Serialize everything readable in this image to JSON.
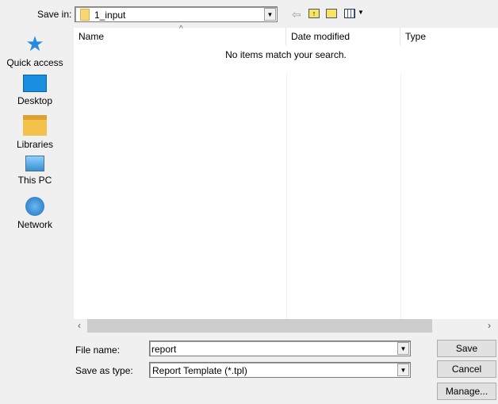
{
  "toolbar": {
    "save_in_label": "Save in:",
    "folder": "1_input"
  },
  "sidebar": {
    "items": [
      {
        "label": "Quick access",
        "icon": "star-icon"
      },
      {
        "label": "Desktop",
        "icon": "desktop-icon"
      },
      {
        "label": "Libraries",
        "icon": "libraries-icon"
      },
      {
        "label": "This PC",
        "icon": "computer-icon"
      },
      {
        "label": "Network",
        "icon": "network-icon"
      }
    ]
  },
  "list": {
    "columns": [
      "Name",
      "Date modified",
      "Type"
    ],
    "empty_message": "No items match your search."
  },
  "form": {
    "file_name_label": "File name:",
    "file_name_value": "report",
    "type_label": "Save as type:",
    "type_value": "Report Template (*.tpl)"
  },
  "buttons": {
    "save": "Save",
    "cancel": "Cancel",
    "manage": "Manage..."
  }
}
